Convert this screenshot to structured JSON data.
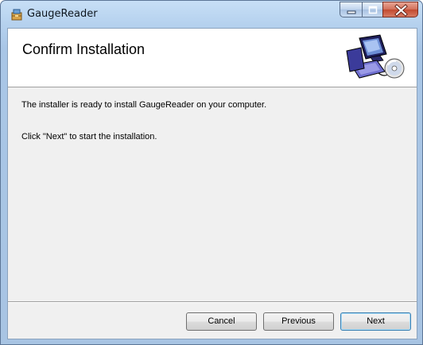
{
  "window": {
    "title": "GaugeReader",
    "app_icon": "installer-package-icon",
    "controls": {
      "minimize": "minimize-icon",
      "maximize": "maximize-icon",
      "close": "close-icon"
    }
  },
  "header": {
    "title": "Confirm Installation",
    "graphic": "computer-disc-icon"
  },
  "body": {
    "line1": "The installer is ready to install GaugeReader on your computer.",
    "line2": "Click \"Next\" to start the installation."
  },
  "buttons": {
    "cancel": "Cancel",
    "previous": "Previous",
    "next": "Next"
  },
  "colors": {
    "titlebar": "#b5d1ee",
    "client_bg": "#f0f0f0",
    "close_button": "#c24a30"
  }
}
